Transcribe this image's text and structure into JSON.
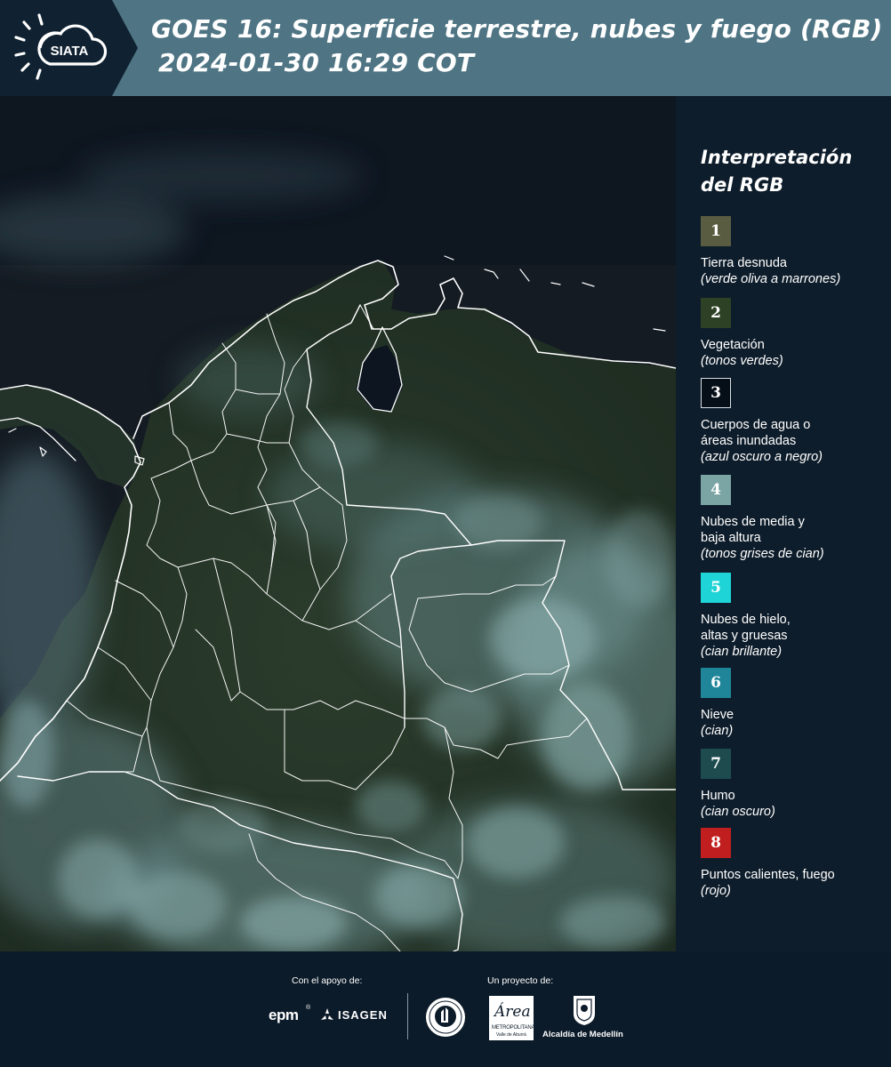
{
  "header": {
    "logo_text": "SIATA",
    "title_line1": "GOES 16: Superficie terrestre, nubes y fuego (RGB)",
    "title_line2": "2024-01-30 16:29 COT"
  },
  "legend": {
    "title": "Interpretación del RGB",
    "items": [
      {
        "number": "1",
        "label": "Tierra desnuda",
        "note": "(verde oliva a marrones)",
        "color": "#5a5c42"
      },
      {
        "number": "2",
        "label": "Vegetación",
        "note": "(tonos verdes)",
        "color": "#2d4124"
      },
      {
        "number": "3",
        "label": "Cuerpos de agua o\náreas inundadas",
        "note": "(azul oscuro a negro)",
        "color": "#060f18"
      },
      {
        "number": "4",
        "label": "Nubes de media y\nbaja altura",
        "note": "(tonos grises de cian)",
        "color": "#7ba4a4"
      },
      {
        "number": "5",
        "label": "Nubes de hielo,\naltas y gruesas",
        "note": "(cian brillante)",
        "color": "#1fd4d6"
      },
      {
        "number": "6",
        "label": "Nieve",
        "note": "(cian)",
        "color": "#1f8598"
      },
      {
        "number": "7",
        "label": "Humo",
        "note": "(cian oscuro)",
        "color": "#1d4b4e"
      },
      {
        "number": "8",
        "label": "Puntos calientes, fuego",
        "note": "(rojo)",
        "color": "#c11f1f"
      }
    ]
  },
  "footer": {
    "support_caption": "Con el apoyo de:",
    "project_caption": "Un proyecto de:",
    "sponsor_epm": "epm",
    "sponsor_isagen": "ISAGEN",
    "sponsor_area": "Área",
    "sponsor_area_sub": "METROPOLITANA",
    "sponsor_area_sub2": "Valle de Aburrá",
    "sponsor_alcaldia": "Alcaldía de Medellín"
  },
  "colors": {
    "header_bg": "#4f7584",
    "panel_bg": "#0e1d2b",
    "border_lines": "#ffffff"
  }
}
